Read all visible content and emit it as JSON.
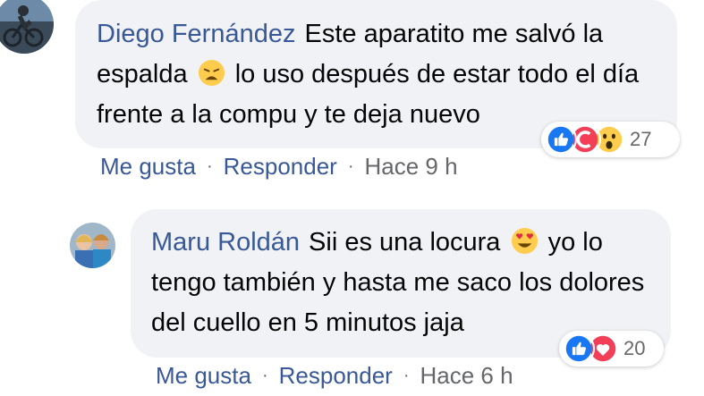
{
  "comments": [
    {
      "author": "Diego Fernández",
      "text_before": "Este aparatito me salvó la espalda",
      "emoji": "weary-face",
      "text_after": "lo uso después de estar todo el día frente a la compu y te deja nuevo",
      "reactions": [
        "like",
        "care",
        "wow"
      ],
      "reaction_count": "27",
      "actions": {
        "like": "Me gusta",
        "reply": "Responder",
        "time": "Hace 9 h"
      }
    },
    {
      "author": "Maru Roldán",
      "text_before": "Sii es una locura",
      "emoji": "heart-eyes-face",
      "text_after": "yo lo tengo también y hasta me saco los dolores del cuello en 5 minutos jaja",
      "reactions": [
        "like",
        "love"
      ],
      "reaction_count": "20",
      "actions": {
        "like": "Me gusta",
        "reply": "Responder",
        "time": "Hace 6 h"
      }
    }
  ],
  "colors": {
    "author": "#385898",
    "bubble": "#f0f2f5",
    "muted": "#65676b",
    "like": "#1877f2",
    "love": "#f33e58"
  }
}
